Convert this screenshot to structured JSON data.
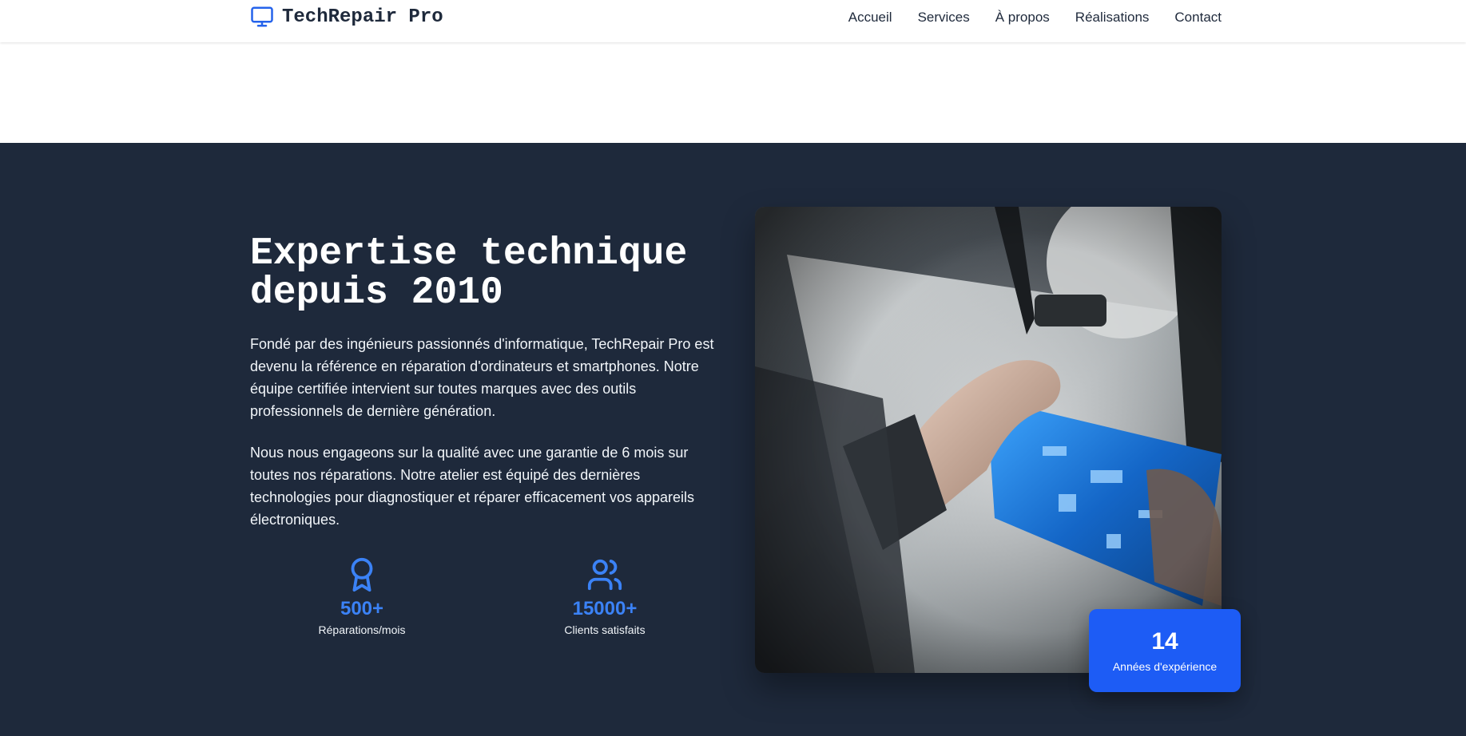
{
  "brand": {
    "name": "TechRepair Pro",
    "icon": "monitor-icon",
    "accent_color": "#2563eb"
  },
  "nav": {
    "items": [
      {
        "label": "Accueil"
      },
      {
        "label": "Services"
      },
      {
        "label": "À propos"
      },
      {
        "label": "Réalisations"
      },
      {
        "label": "Contact"
      }
    ]
  },
  "about": {
    "title_line1": "Expertise technique",
    "title_line2": "depuis 2010",
    "paragraph1": "Fondé par des ingénieurs passionnés d'informatique, TechRepair Pro est devenu la référence en réparation d'ordinateurs et smartphones. Notre équipe certifiée intervient sur toutes marques avec des outils professionnels de dernière génération.",
    "paragraph2": "Nous nous engageons sur la qualité avec une garantie de 6 mois sur toutes nos réparations. Notre atelier est équipé des dernières technologies pour diagnostiquer et réparer efficacement vos appareils électroniques.",
    "background_color": "#1e293b",
    "stats": [
      {
        "icon": "award-icon",
        "value": "500+",
        "label": "Réparations/mois"
      },
      {
        "icon": "users-icon",
        "value": "15000+",
        "label": "Clients satisfaits"
      }
    ],
    "stat_color": "#3b82f6",
    "image": {
      "icon": "circuit-board-repair-photo"
    },
    "experience_badge": {
      "value": "14",
      "label": "Années d'expérience",
      "color": "#1d5cf5"
    }
  }
}
